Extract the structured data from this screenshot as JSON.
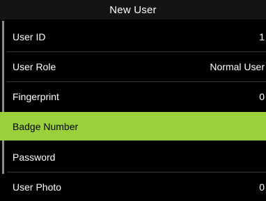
{
  "header": {
    "title": "New User"
  },
  "menu": {
    "items": [
      {
        "label": "User ID",
        "value": "1"
      },
      {
        "label": "User Role",
        "value": "Normal User"
      },
      {
        "label": "Fingerprint",
        "value": "0"
      },
      {
        "label": "Badge Number",
        "value": ""
      },
      {
        "label": "Password",
        "value": ""
      },
      {
        "label": "User Photo",
        "value": "0"
      }
    ],
    "selected_label": "Badge Number"
  },
  "colors": {
    "background": "#000000",
    "title_bar": "#141414",
    "selection": "#9ad13a",
    "divider": "#3a3a3a",
    "scrollbar": "#8a8a8a"
  }
}
